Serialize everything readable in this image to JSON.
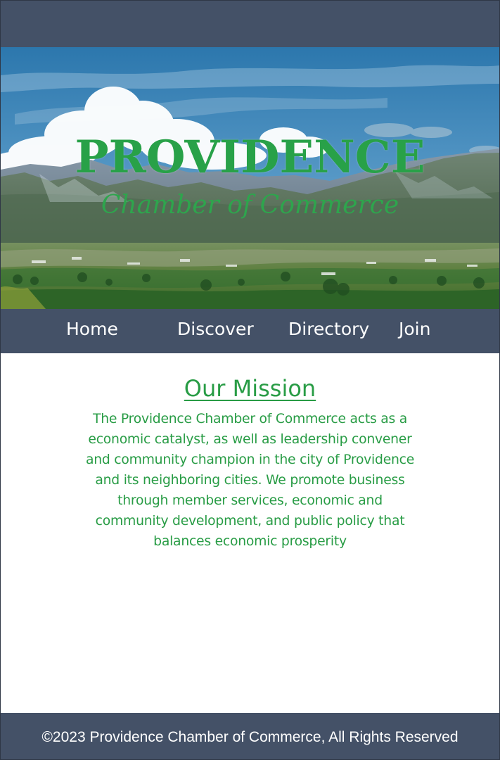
{
  "header": {
    "title": "PROVIDENCE",
    "subtitle": "Chamber of Commerce"
  },
  "nav": {
    "items": [
      {
        "label": "Home"
      },
      {
        "label": "Discover"
      },
      {
        "label": "Directory"
      },
      {
        "label": "Join"
      }
    ]
  },
  "mission": {
    "title": "Our Mission",
    "text": "The Providence Chamber of Commerce acts as a economic catalyst, as well as leadership convener and community champion in the city of Providence and its neighboring cities. We promote business through member services, economic and community development, and public policy that balances economic prosperity"
  },
  "footer": {
    "text": "©2023 Providence Chamber of Commerce, All Rights Reserved"
  },
  "colors": {
    "header_background": "#445167",
    "brand_green": "#289c45",
    "nav_text": "#ffffff"
  }
}
